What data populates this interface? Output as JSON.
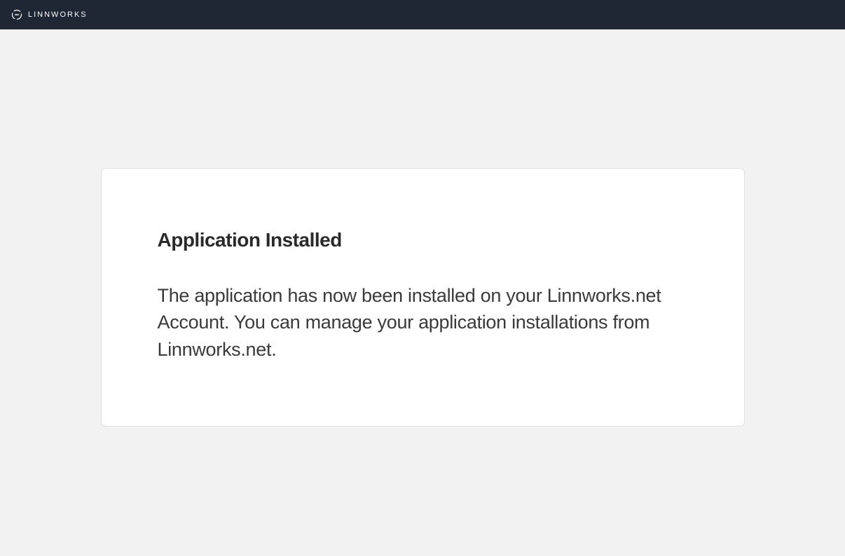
{
  "header": {
    "brand": "LINNWORKS"
  },
  "card": {
    "title": "Application Installed",
    "body": "The application has now been installed on your Linnworks.net Account. You can manage your application installations from Linnworks.net."
  }
}
